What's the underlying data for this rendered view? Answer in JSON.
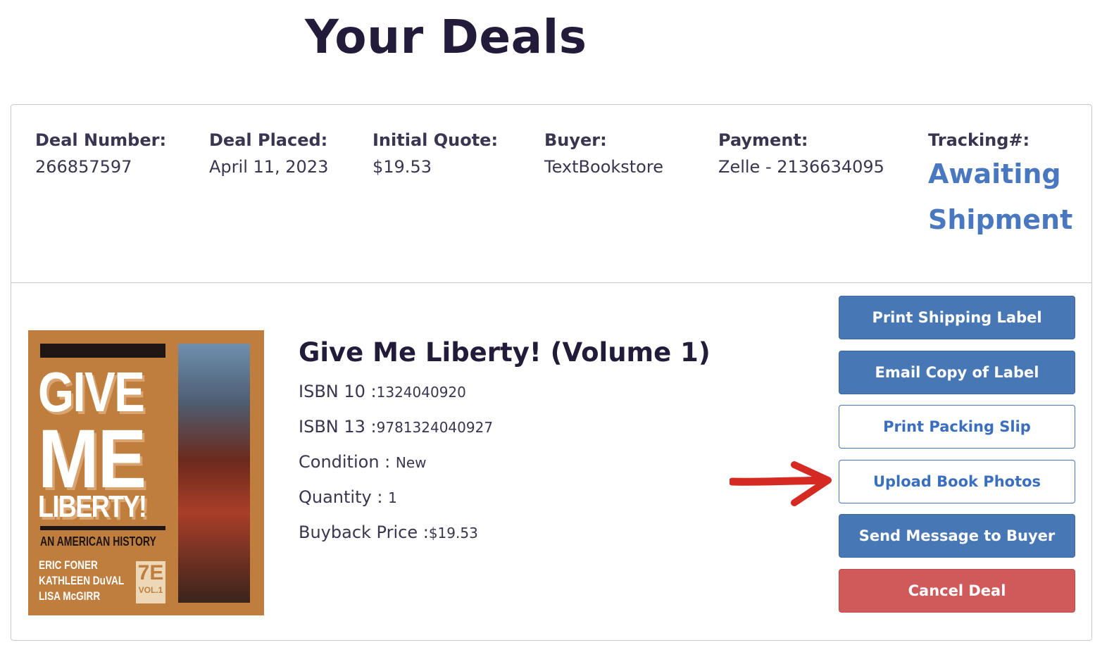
{
  "page": {
    "title": "Your Deals"
  },
  "deal": {
    "summary": [
      {
        "label": "Deal Number:",
        "value": "266857597"
      },
      {
        "label": "Deal Placed:",
        "value": "April 11, 2023"
      },
      {
        "label": "Initial Quote:",
        "value": "$19.53"
      },
      {
        "label": "Buyer:",
        "value": "TextBookstore"
      },
      {
        "label": "Payment:",
        "value": "Zelle - 2136634095"
      }
    ],
    "tracking": {
      "label": "Tracking#:",
      "value": "Awaiting Shipment"
    },
    "book": {
      "title": "Give Me Liberty! (Volume 1)",
      "details": [
        {
          "label": "ISBN 10 :",
          "value": "1324040920"
        },
        {
          "label": "ISBN 13 :",
          "value": "9781324040927"
        },
        {
          "label": "Condition : ",
          "value": "New"
        },
        {
          "label": "Quantity : ",
          "value": "1"
        },
        {
          "label": "Buyback Price :",
          "value": "$19.53"
        }
      ],
      "cover": {
        "line1": "GIVE",
        "line2": "ME",
        "line3": "LIBERTY!",
        "subtitle": "AN AMERICAN HISTORY",
        "authors": [
          "ERIC FONER",
          "KATHLEEN DuVAL",
          "LISA McGIRR"
        ],
        "edition": "7E",
        "volume": "VOL.1"
      }
    },
    "actions": {
      "print_shipping_label": "Print Shipping Label",
      "email_copy_of_label": "Email Copy of Label",
      "print_packing_slip": "Print Packing Slip",
      "upload_book_photos": "Upload Book Photos",
      "send_message_to_buyer": "Send Message to Buyer",
      "cancel_deal": "Cancel Deal"
    }
  },
  "colors": {
    "primary": "#4877b5",
    "link": "#4a78c0",
    "danger": "#d05a5a",
    "annotation_arrow": "#d42a22",
    "heading": "#221c3a"
  },
  "icons": {
    "annotation": "red-arrow-icon"
  }
}
